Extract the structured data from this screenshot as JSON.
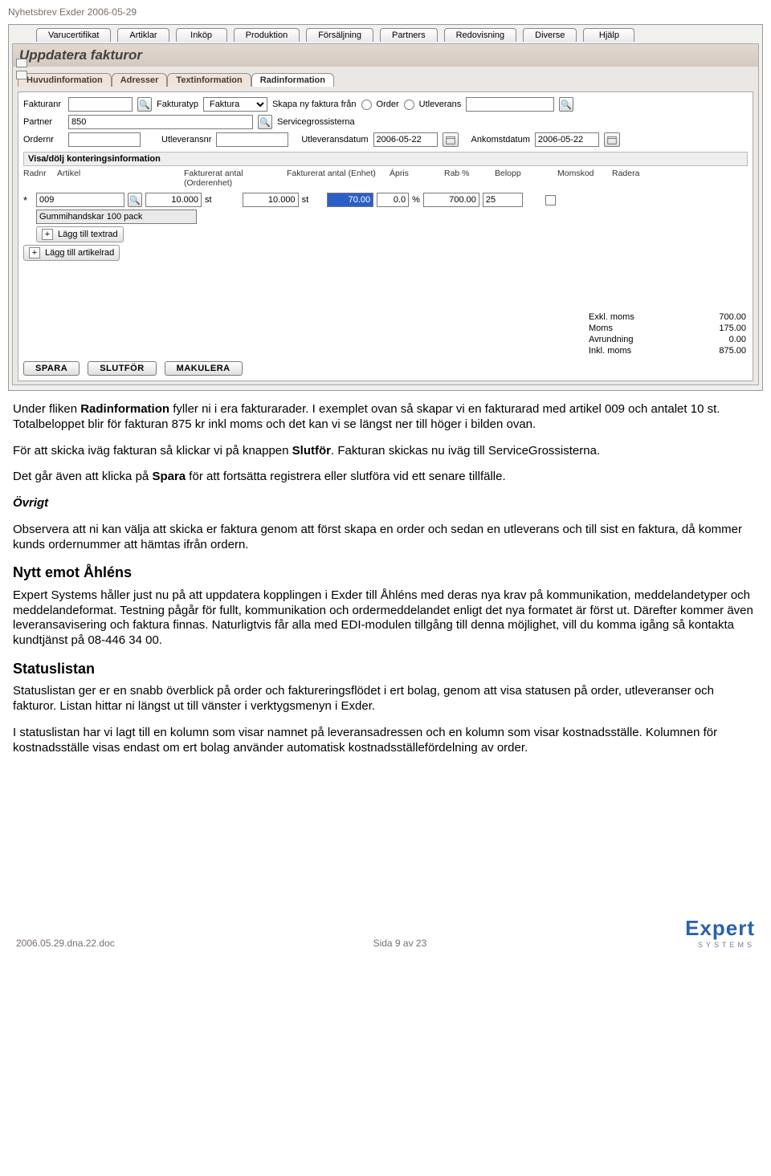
{
  "header": "Nyhetsbrev Exder 2006-05-29",
  "app": {
    "main_tabs": [
      "Varucertifikat",
      "Artiklar",
      "Inköp",
      "Produktion",
      "Försäljning",
      "Partners",
      "Redovisning",
      "Diverse",
      "Hjälp"
    ],
    "title": "Uppdatera fakturor",
    "sub_tabs": [
      {
        "label": "Huvudinformation",
        "active": false
      },
      {
        "label": "Adresser",
        "active": false
      },
      {
        "label": "Textinformation",
        "active": false
      },
      {
        "label": "Radinformation",
        "active": true
      }
    ],
    "form": {
      "fakturanr_lbl": "Fakturanr",
      "fakturanr_val": "",
      "fakturatyp_lbl": "Fakturatyp",
      "fakturatyp_val": "Faktura",
      "skapa_lbl": "Skapa ny faktura från",
      "opt_order": "Order",
      "opt_utlev": "Utleverans",
      "partner_lbl": "Partner",
      "partner_val": "850",
      "partner_name": "Servicegrossisterna",
      "ordernr_lbl": "Ordernr",
      "ordernr_val": "",
      "utlevnr_lbl": "Utleveransnr",
      "utlevnr_val": "",
      "utlevdat_lbl": "Utleveransdatum",
      "utlevdat_val": "2006-05-22",
      "ankomst_lbl": "Ankomstdatum",
      "ankomst_val": "2006-05-22"
    },
    "section_head": "Visa/dölj konteringsinformation",
    "cols": {
      "radnr": "Radnr",
      "artikel": "Artikel",
      "fakt_order": "Fakturerat antal (Orderenhet)",
      "fakt_enhet": "Fakturerat antal (Enhet)",
      "apris": "Ápris",
      "rab": "Rab %",
      "belopp": "Belopp",
      "momskod": "Momskod",
      "radera": "Radera"
    },
    "line": {
      "artikel": "009",
      "q1": "10.000",
      "u1": "st",
      "q2": "10.000",
      "u2": "st",
      "apris": "70.00",
      "rab": "0.0",
      "pct": "%",
      "belopp": "700.00",
      "momskod": "25",
      "desc": "Gummihandskar 100 pack",
      "add_text": "Lägg till textrad",
      "add_art": "Lägg till artikelrad"
    },
    "totals": {
      "exkl_l": "Exkl. moms",
      "exkl_v": "700.00",
      "moms_l": "Moms",
      "moms_v": "175.00",
      "avr_l": "Avrundning",
      "avr_v": "0.00",
      "inkl_l": "Inkl. moms",
      "inkl_v": "875.00"
    },
    "buttons": {
      "spara": "SPARA",
      "slutfor": "SLUTFÖR",
      "makulera": "MAKULERA"
    }
  },
  "article": {
    "p1a": "Under fliken ",
    "p1b": "Radinformation",
    "p1c": " fyller ni i era fakturarader. I exemplet ovan så skapar vi en fakturarad med artikel 009 och antalet 10 st. Totalbeloppet blir för fakturan 875 kr inkl moms och det kan vi se längst ner till höger i bilden ovan.",
    "p2a": "För att skicka iväg fakturan så klickar vi på knappen ",
    "p2b": "Slutför",
    "p2c": ". Fakturan skickas nu iväg till ServiceGrossisterna.",
    "p3a": "Det går även att klicka på ",
    "p3b": "Spara",
    "p3c": " för att fortsätta registrera eller slutföra vid ett senare tillfälle.",
    "h_ovrigt": "Övrigt",
    "p4": "Observera att ni kan välja att skicka er faktura genom att först skapa en order och sedan en utleverans och till sist en faktura, då kommer kunds ordernummer att hämtas ifrån ordern.",
    "h_ahlens": "Nytt emot Åhléns",
    "p5": "Expert Systems håller just nu på att uppdatera kopplingen i Exder till Åhléns med deras nya krav på kommunikation, meddelandetyper och meddelandeformat. Testning pågår för fullt, kommunikation och ordermeddelandet enligt det nya formatet är först ut. Därefter kommer även leveransavisering och faktura finnas. Naturligtvis får alla med EDI-modulen tillgång till denna möjlighet, vill du komma igång så kontakta kundtjänst på 08-446 34 00.",
    "h_status": "Statuslistan",
    "p6": "Statuslistan ger er en snabb överblick på order och faktureringsflödet i ert bolag, genom att visa statusen på order, utleveranser och fakturor. Listan hittar ni längst ut till vänster i verktygsmenyn i Exder.",
    "p7": "I statuslistan har vi lagt till en kolumn som visar namnet på leveransadressen och en kolumn som visar kostnadsställe. Kolumnen för kostnadsställe visas endast om ert bolag använder automatisk kostnadsställefördelning av order."
  },
  "footer": {
    "file": "2006.05.29.dna.22.doc",
    "page": "Sida 9 av 23",
    "logo_big": "Expert",
    "logo_small": "SYSTEMS"
  }
}
